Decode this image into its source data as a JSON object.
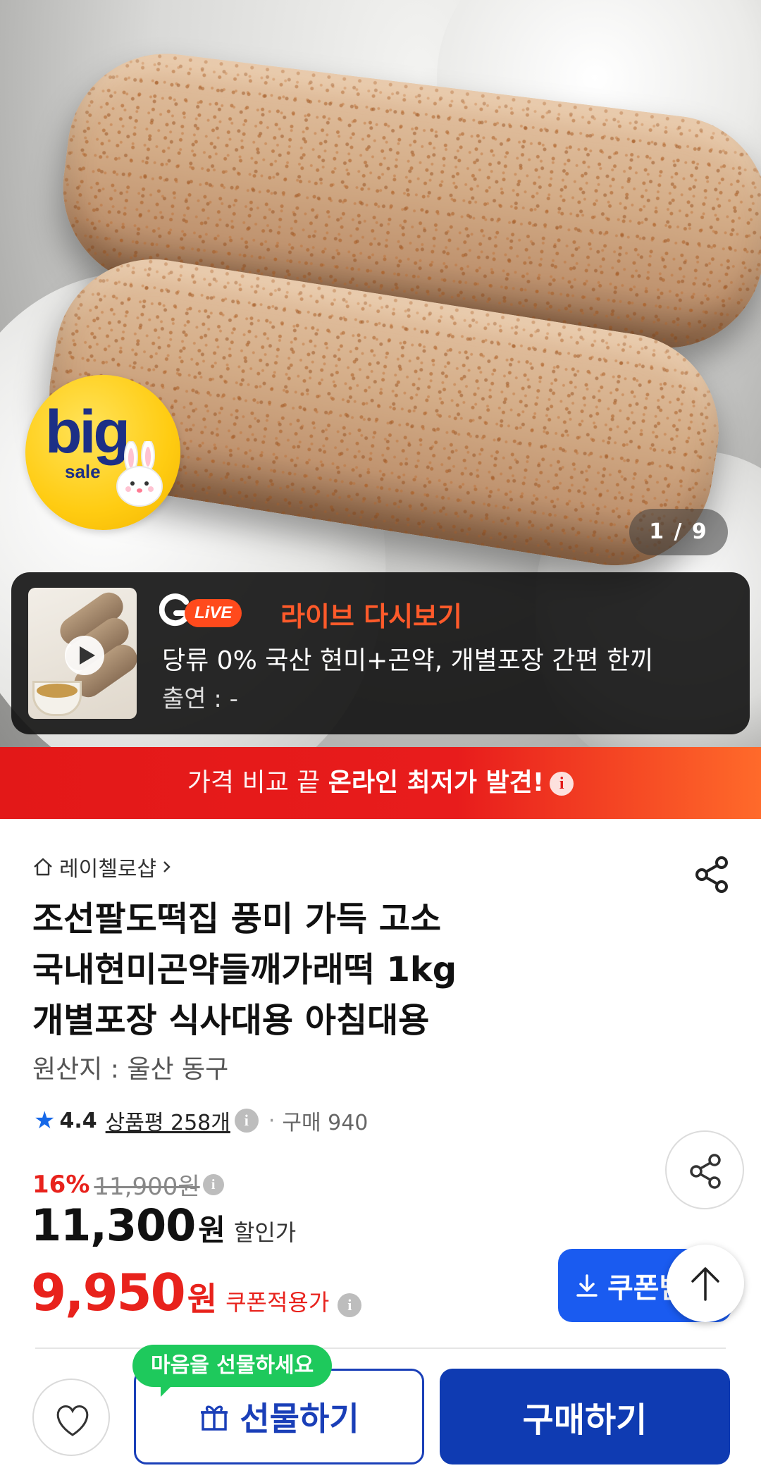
{
  "gallery": {
    "counter": "1 / 9",
    "badge": {
      "big": "big",
      "sale": "sale"
    }
  },
  "live": {
    "badge": "LiVE",
    "title": "라이브 다시보기",
    "description": "당류 0% 국산 현미+곤약, 개별포장 간편 한끼",
    "cast": "출연 : -"
  },
  "price_banner": {
    "text_light": "가격 비교 끝 ",
    "text_bold": "온라인 최저가 발견!"
  },
  "product": {
    "shop": "레이첼로샵",
    "title_line1": "조선팔도떡집 풍미 가득 고소",
    "title_line2": "국내현미곤약들깨가래떡 1kg",
    "title_line3": "개별포장 식사대용 아침대용",
    "origin": "원산지 : 울산 동구",
    "rating": "4.4",
    "review_text": "상품평 258개",
    "purchase_text": "구매 940",
    "discount_rate": "16%",
    "original_price": "11,900원",
    "sale_price": "11,300",
    "currency": "원",
    "sale_label": "할인가",
    "coupon_price": "9,950",
    "coupon_label": "쿠폰적용가"
  },
  "buttons": {
    "coupon": "쿠폰받",
    "gift_bubble": "마음을 선물하세요",
    "gift": "선물하기",
    "buy": "구매하기"
  },
  "colors": {
    "accent_red": "#e8221c",
    "brand_blue": "#0f3bb2",
    "coupon_blue": "#1a5bf0",
    "live_orange": "#ff5a2a",
    "gift_green": "#1ec95c"
  }
}
